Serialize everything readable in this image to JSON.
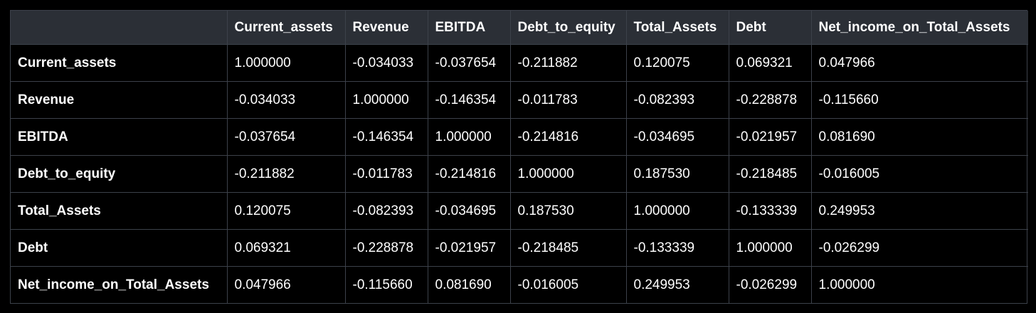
{
  "table": {
    "columns": [
      "",
      "Current_assets",
      "Revenue",
      "EBITDA",
      "Debt_to_equity",
      "Total_Assets",
      "Debt",
      "Net_income_on_Total_Assets"
    ],
    "rows": [
      {
        "label": "Current_assets",
        "values": [
          "1.000000",
          "-0.034033",
          "-0.037654",
          "-0.211882",
          "0.120075",
          "0.069321",
          "0.047966"
        ]
      },
      {
        "label": "Revenue",
        "values": [
          "-0.034033",
          "1.000000",
          "-0.146354",
          "-0.011783",
          "-0.082393",
          "-0.228878",
          "-0.115660"
        ]
      },
      {
        "label": "EBITDA",
        "values": [
          "-0.037654",
          "-0.146354",
          "1.000000",
          "-0.214816",
          "-0.034695",
          "-0.021957",
          "0.081690"
        ]
      },
      {
        "label": "Debt_to_equity",
        "values": [
          "-0.211882",
          "-0.011783",
          "-0.214816",
          "1.000000",
          "0.187530",
          "-0.218485",
          "-0.016005"
        ]
      },
      {
        "label": "Total_Assets",
        "values": [
          "0.120075",
          "-0.082393",
          "-0.034695",
          "0.187530",
          "1.000000",
          "-0.133339",
          "0.249953"
        ]
      },
      {
        "label": "Debt",
        "values": [
          "0.069321",
          "-0.228878",
          "-0.021957",
          "-0.218485",
          "-0.133339",
          "1.000000",
          "-0.026299"
        ]
      },
      {
        "label": "Net_income_on_Total_Assets",
        "values": [
          "0.047966",
          "-0.115660",
          "0.081690",
          "-0.016005",
          "0.249953",
          "-0.026299",
          "1.000000"
        ]
      }
    ]
  },
  "colors": {
    "background": "#000000",
    "header_background": "#2b2f36",
    "grid_line": "#3c414a",
    "text": "#ffffff"
  }
}
